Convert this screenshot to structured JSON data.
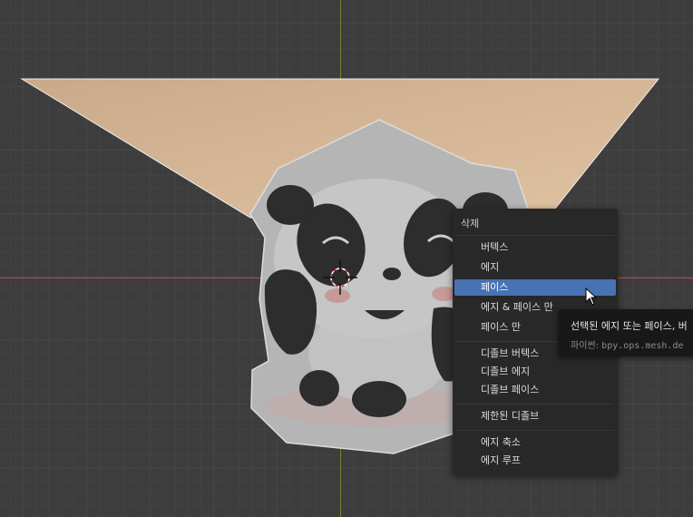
{
  "colors": {
    "viewport_bg": "#3d3d3d",
    "face_fill": "#d8b690",
    "menu_bg": "#282828",
    "highlight": "#4772b3",
    "tooltip_bg": "#181818",
    "x_axis": "#b24b50",
    "y_axis": "#6b8a2c"
  },
  "viewport": {
    "reference_image": "panda-image",
    "cursor_icon": "3d-cursor-icon"
  },
  "menu": {
    "title": "삭제",
    "items": [
      {
        "label": "버텍스"
      },
      {
        "label": "에지"
      },
      {
        "label": "페이스",
        "active": true
      },
      {
        "label": "에지 & 페이스 만"
      },
      {
        "label": "페이스 만"
      },
      {
        "label": "디졸브 버텍스"
      },
      {
        "label": "디졸브 에지"
      },
      {
        "label": "디졸브 페이스"
      },
      {
        "label": "제한된 디졸브"
      },
      {
        "label": "에지 축소"
      },
      {
        "label": "에지 루프"
      }
    ]
  },
  "tooltip": {
    "description": "선택된 에지 또는 페이스, 버",
    "python_label": "파이썬:",
    "python_command": "bpy.ops.mesh.de"
  },
  "mouse_pointer": "arrow-pointer-icon"
}
